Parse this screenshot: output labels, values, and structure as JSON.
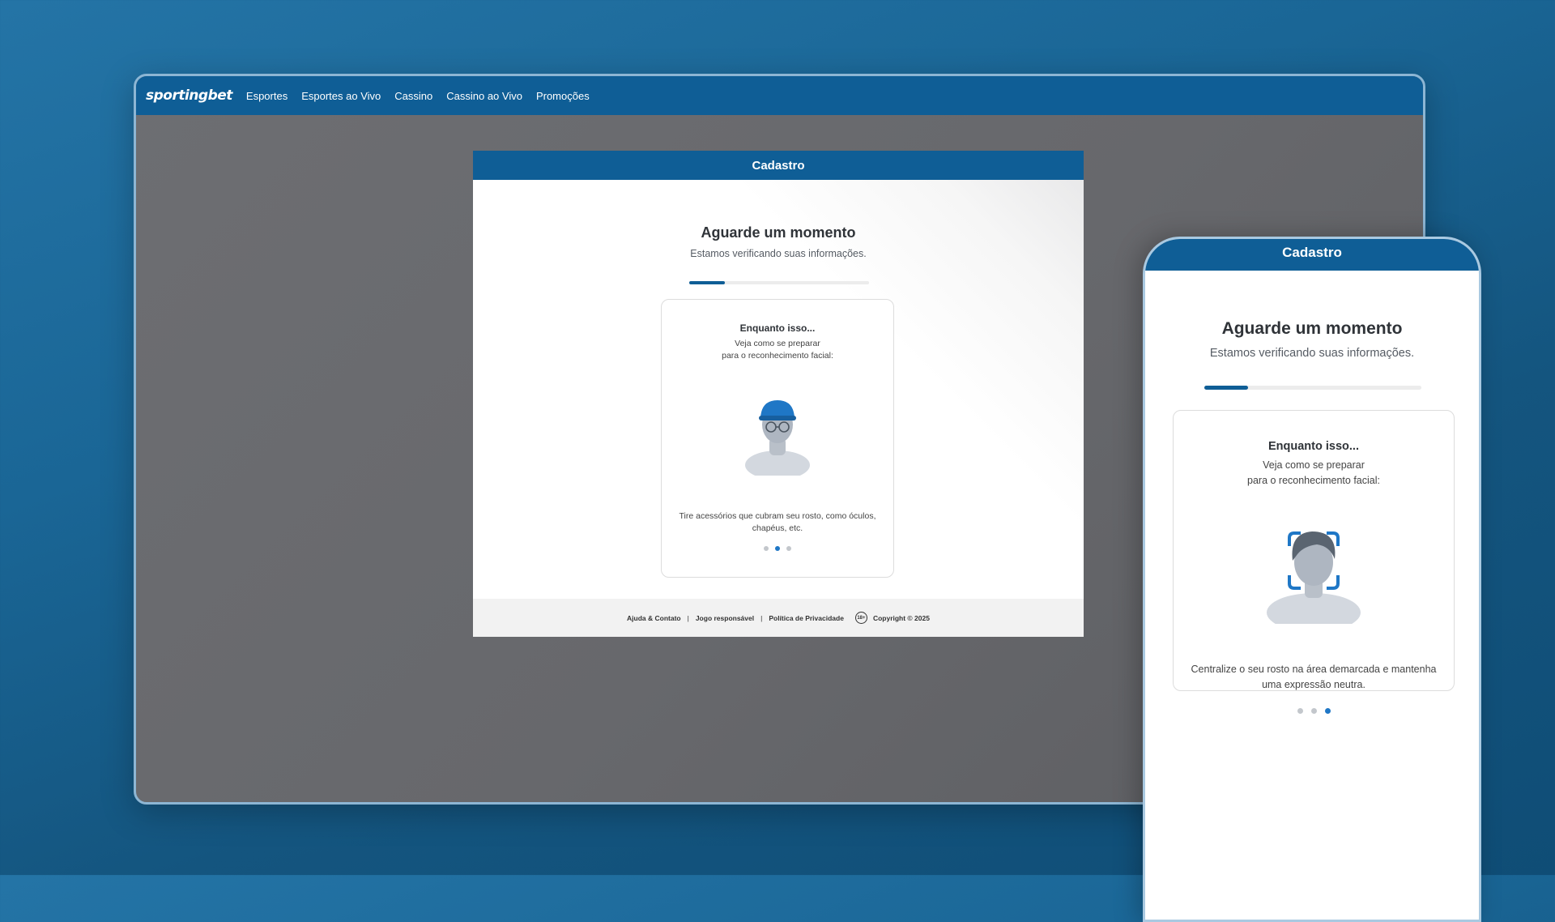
{
  "desktop": {
    "brand": "sportingbet",
    "nav": [
      "Esportes",
      "Esportes ao Vivo",
      "Cassino",
      "Cassino ao Vivo",
      "Promoções"
    ],
    "modal": {
      "header": "Cadastro",
      "title": "Aguarde um momento",
      "subtitle": "Estamos verificando suas informações.",
      "progress": 0.2,
      "card": {
        "title": "Enquanto isso...",
        "subtitle_line1": "Veja como se preparar",
        "subtitle_line2": "para o reconhecimento facial:",
        "illustration": "person-with-cap-and-glasses-icon",
        "tip": "Tire acessórios que cubram seu rosto, como óculos, chapéus, etc.",
        "active_slide": 2,
        "slides": 3
      },
      "footer": {
        "help": "Ajuda & Contato",
        "responsible": "Jogo responsável",
        "privacy": "Política de Privacidade",
        "age_badge": "18+",
        "copyright": "Copyright © 2025"
      }
    }
  },
  "phone": {
    "header": "Cadastro",
    "title": "Aguarde um momento",
    "subtitle": "Estamos verificando suas informações.",
    "progress": 0.2,
    "card": {
      "title": "Enquanto isso...",
      "subtitle_line1": "Veja como se preparar",
      "subtitle_line2": "para o reconhecimento facial:",
      "illustration": "face-frame-person-icon",
      "tip": "Centralize o seu rosto na área demarcada e mantenha uma expressão neutra.",
      "active_slide": 3,
      "slides": 3
    }
  },
  "colors": {
    "brand_blue": "#0f5e96",
    "active_dot": "#1f77c6",
    "cap_blue": "#1f77c6"
  }
}
